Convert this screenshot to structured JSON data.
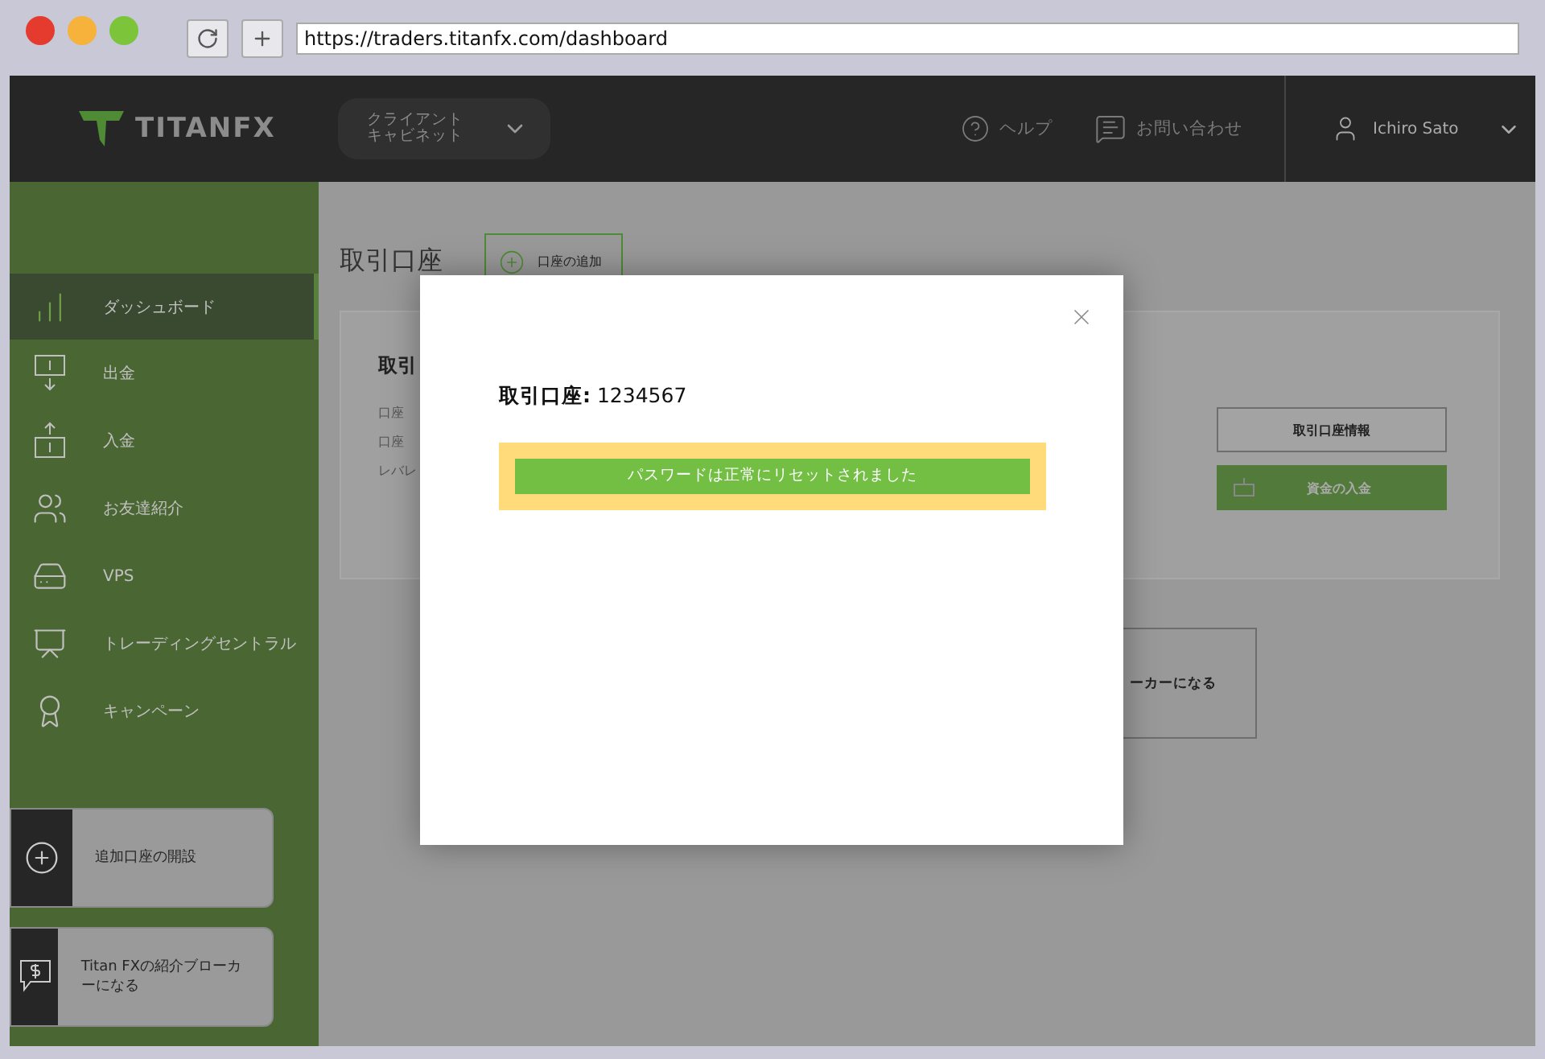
{
  "browser": {
    "url": "https://traders.titanfx.com/dashboard"
  },
  "header": {
    "logo": "TITANFX",
    "cabinet": [
      "クライアント",
      "キャビネット"
    ],
    "help": "ヘルプ",
    "contact": "お問い合わせ",
    "user": "Ichiro Sato"
  },
  "sidebar": {
    "items": [
      {
        "kind": "dashboard",
        "label": "ダッシュボード",
        "selected": true
      },
      {
        "kind": "withdraw",
        "label": "出金",
        "selected": false
      },
      {
        "kind": "deposit",
        "label": "入金",
        "selected": false
      },
      {
        "kind": "referral",
        "label": "お友達紹介",
        "selected": false
      },
      {
        "kind": "vps",
        "label": "VPS",
        "selected": false
      },
      {
        "kind": "trading",
        "label": "トレーディングセントラル",
        "selected": false
      },
      {
        "kind": "campaign",
        "label": "キャンペーン",
        "selected": false
      }
    ],
    "cards": [
      {
        "kind": "add",
        "label": "追加口座の開設"
      },
      {
        "kind": "broker",
        "label": "Titan FXの紹介ブローカーになる"
      }
    ]
  },
  "main": {
    "title": "取引口座",
    "add_button": "口座の追加",
    "account_card": {
      "title": "取引",
      "lines": [
        "口座",
        "口座",
        "レバレ"
      ],
      "info_button": "取引口座情報",
      "deposit_button": "資金の入金"
    },
    "broker_card": {
      "label": "ーカーになる"
    }
  },
  "modal": {
    "title": "**取引口座:** 1234567",
    "message": "パスワードは正常にリセットされました"
  }
}
